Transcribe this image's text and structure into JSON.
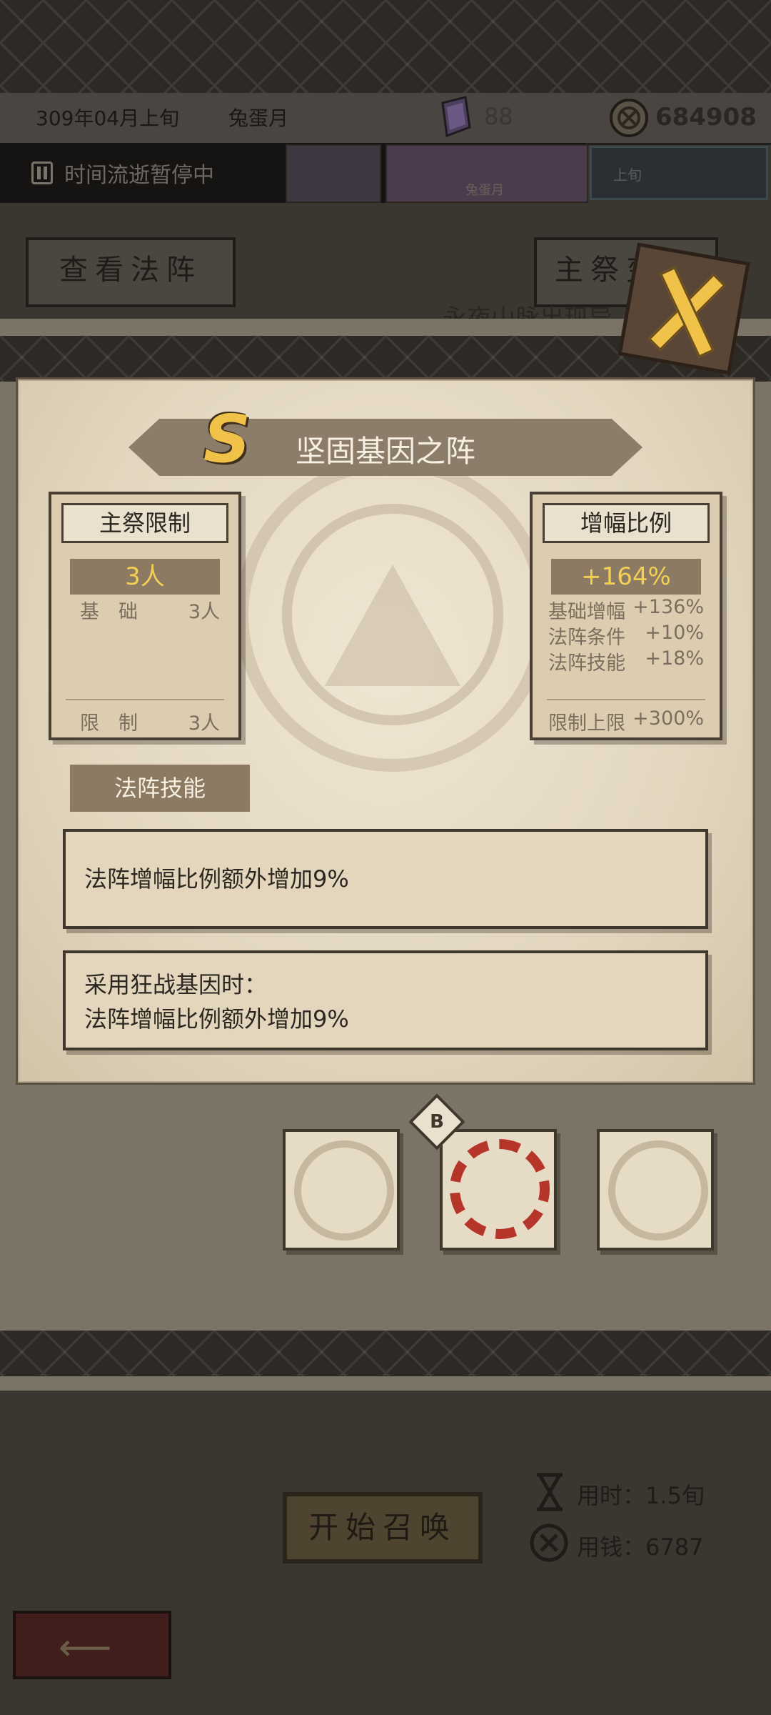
{
  "header": {
    "date": "309年04月上旬",
    "month_name": "兔蛋月",
    "gem_count": "88",
    "coin_count": "684908"
  },
  "pause_bar": {
    "label": "时间流逝暂停中"
  },
  "timeline": {
    "event_label": "兔蛋月",
    "tab_label": "上旬"
  },
  "background_buttons": {
    "view_array": "查看法阵",
    "main_ritual": "主祭变更",
    "behind_text": "永夜山脉出现异"
  },
  "dialog": {
    "rank": "S",
    "title": "坚固基因之阵",
    "left_box": {
      "header": "主祭限制",
      "highlight": "3人",
      "rows": [
        {
          "label": "基　础",
          "value": "3人"
        }
      ],
      "footer": {
        "label": "限　制",
        "value": "3人"
      }
    },
    "right_box": {
      "header": "增幅比例",
      "highlight": "+164%",
      "rows": [
        {
          "label": "基础增幅",
          "value": "+136%"
        },
        {
          "label": "法阵条件",
          "value": "+10%"
        },
        {
          "label": "法阵技能",
          "value": "+18%"
        }
      ],
      "footer": {
        "label": "限制上限",
        "value": "+300%"
      }
    },
    "skill_section": {
      "tag": "法阵技能",
      "skills": [
        {
          "line1": "法阵增幅比例额外增加9%",
          "line2": ""
        },
        {
          "line1": "采用狂战基因时：",
          "line2": "法阵增幅比例额外增加9%"
        }
      ]
    },
    "slot_tag": "B"
  },
  "footer": {
    "start_button": "开始召唤",
    "time_used": "用时：1.5旬",
    "money_used": "用钱：6787"
  },
  "colors": {
    "gold": "#f0c24a",
    "parchment": "#e2d6bf",
    "ribbon": "#8c7d6a",
    "red_ring": "#b5352b"
  }
}
